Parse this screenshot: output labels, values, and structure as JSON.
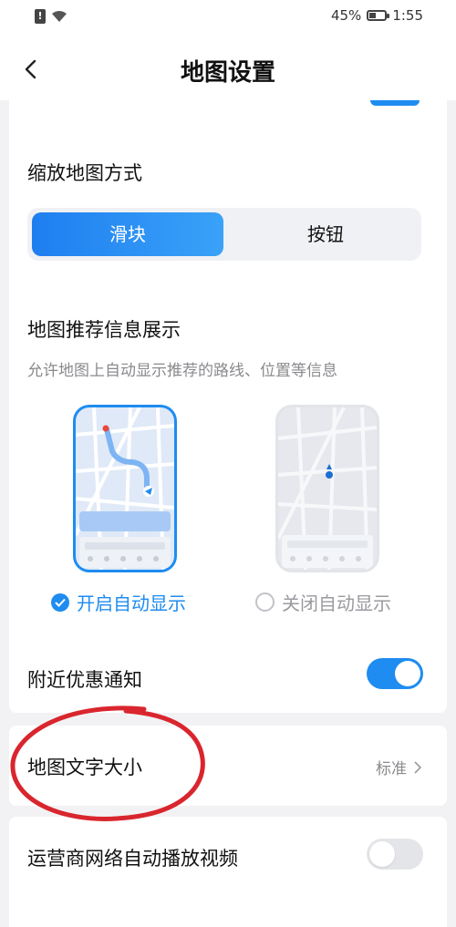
{
  "status_bar": {
    "battery_percent": "45%",
    "battery_level": 0.45,
    "time": "1:55"
  },
  "header": {
    "title": "地图设置"
  },
  "zoom_method": {
    "title": "缩放地图方式",
    "options": [
      "滑块",
      "按钮"
    ],
    "selected": "滑块"
  },
  "recommend": {
    "title": "地图推荐信息展示",
    "description": "允许地图上自动显示推荐的路线、位置等信息",
    "option_on": "开启自动显示",
    "option_off": "关闭自动显示",
    "selected": "开启自动显示"
  },
  "nearby_deals": {
    "label": "附近优惠通知",
    "enabled": true
  },
  "font_size": {
    "label": "地图文字大小",
    "value": "标准"
  },
  "carrier_video": {
    "label": "运营商网络自动播放视频",
    "enabled": false
  },
  "colors": {
    "accent": "#1e8cf0",
    "annotation": "#d9262e"
  }
}
